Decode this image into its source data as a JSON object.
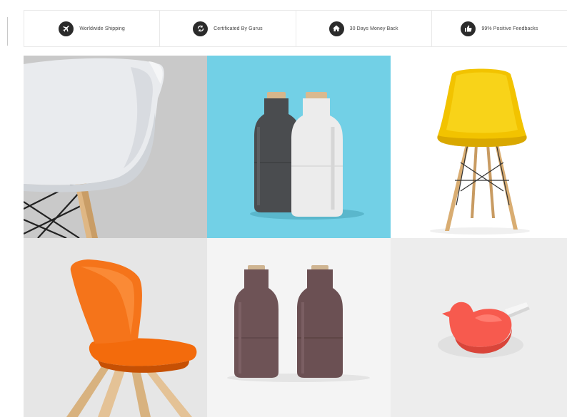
{
  "features": [
    {
      "icon": "airplane-icon",
      "label": "Worldwide Shipping"
    },
    {
      "icon": "refresh-icon",
      "label": "Certificated By Gurus"
    },
    {
      "icon": "home-icon",
      "label": "30 Days Money Back"
    },
    {
      "icon": "thumbs-up-icon",
      "label": "99% Positive Feedbacks"
    }
  ],
  "products": [
    {
      "name": "white-shell-chair-closeup",
      "background": "#c8c8c8"
    },
    {
      "name": "grey-white-grinder-bottles",
      "background": "#72d0e6"
    },
    {
      "name": "yellow-shell-chair",
      "background": "#ffffff"
    },
    {
      "name": "orange-chair",
      "background": "#e6e6e6"
    },
    {
      "name": "brown-grinder-bottles",
      "background": "#f4f4f4"
    },
    {
      "name": "coral-bird-hook",
      "background": "#ededed"
    }
  ]
}
